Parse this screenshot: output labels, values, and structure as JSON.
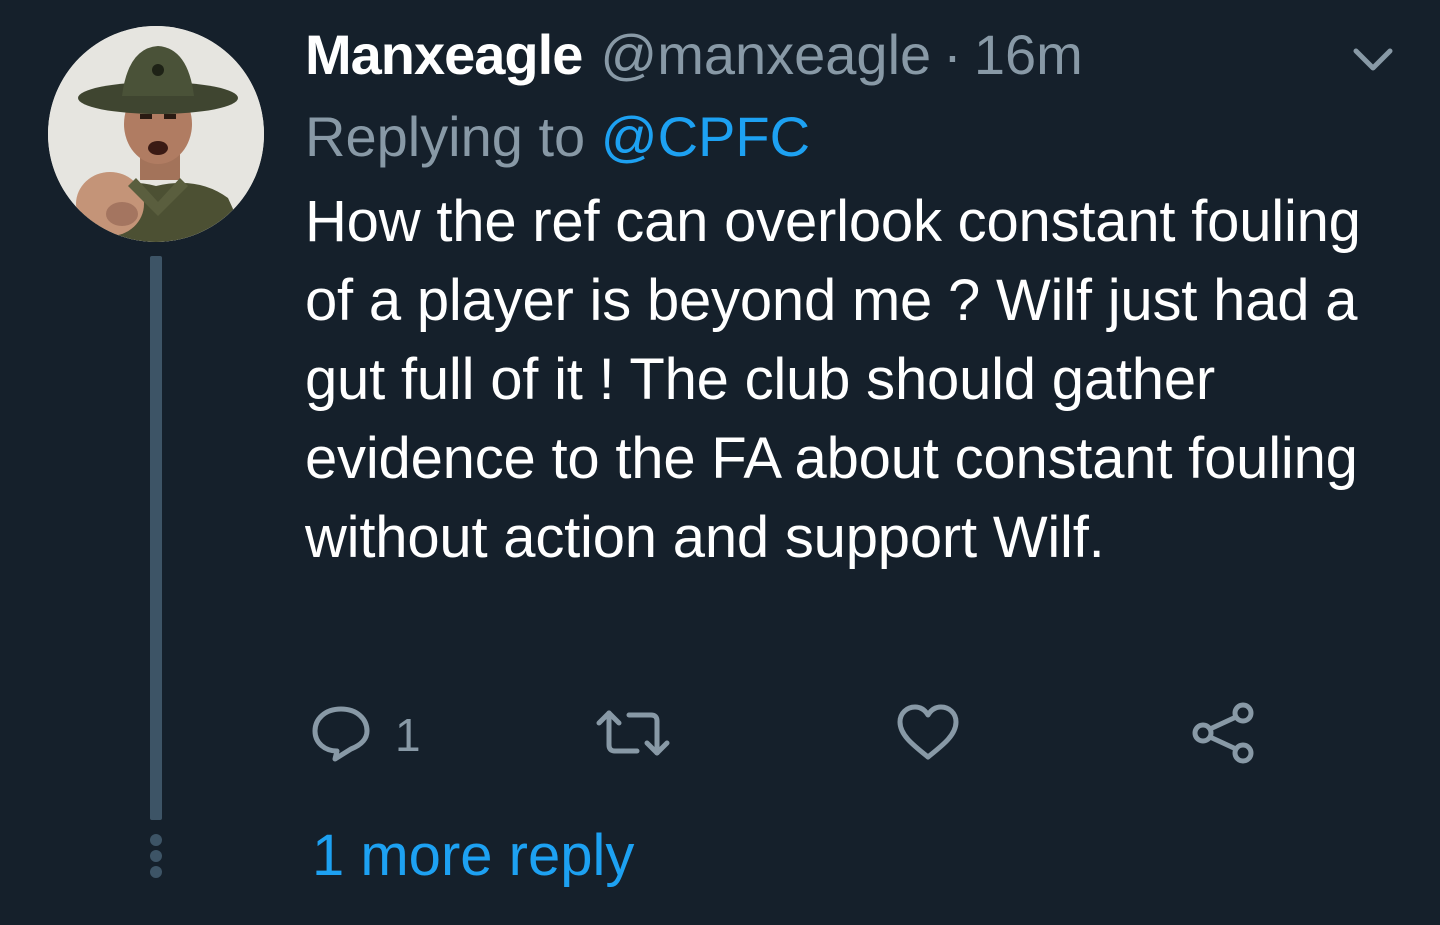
{
  "tweet": {
    "display_name": "Manxeagle",
    "handle": "@manxeagle",
    "separator": "·",
    "timestamp": "16m",
    "replying_prefix": "Replying to ",
    "replying_to": "@CPFC",
    "text": "How the ref can overlook constant fouling of a player is beyond me ? Wilf just had a gut full of it ! The club should gather evidence to the FA about constant fouling without action and support Wilf.",
    "reply_count": "1",
    "more_replies": "1 more reply"
  },
  "icons": {
    "menu": "chevron-down-icon",
    "reply": "reply-icon",
    "retweet": "retweet-icon",
    "like": "heart-icon",
    "share": "share-icon"
  },
  "colors": {
    "background": "#15202b",
    "text": "#ffffff",
    "secondary": "#8899a6",
    "accent": "#1da1f2",
    "thread_line": "#3d5466"
  }
}
